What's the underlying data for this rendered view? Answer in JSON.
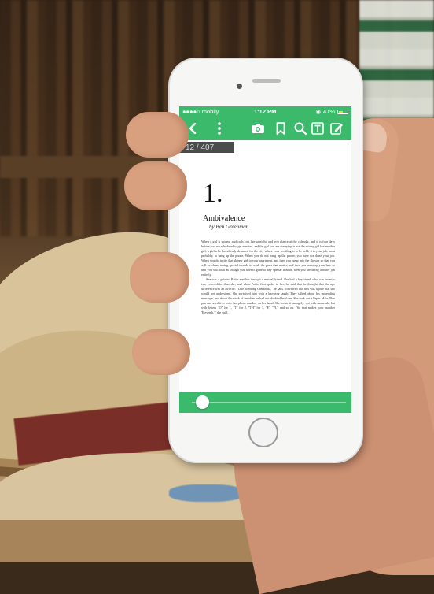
{
  "status_bar": {
    "carrier": "●●●●○ mobily",
    "time": "1:12 PM",
    "battery": "41%",
    "accent_color": "#3cba6c"
  },
  "toolbar": {
    "icons": [
      "back-icon",
      "more-vert-icon",
      "camera-icon",
      "bookmark-icon",
      "search-icon",
      "text-size-icon",
      "edit-note-icon"
    ]
  },
  "reader": {
    "page_counter": "12 / 407",
    "chapter_number": "1.",
    "chapter_title": "Ambivalence",
    "author": "by Ben Greenman",
    "paragraphs": [
      "When a girl is skinny, and calls you late at night, and you glance at the calendar, and it is four days before you are scheduled to get married, and the girl you are marrying is not the skinny girl but another girl, a girl who has already departed for the city where your wedding is to be held, it is your job, most probably, to hang up the phone. When you do not hang up the phone, you have not done your job. When you do invite that skinny girl to your apartment, and then you jump into the shower so that you will be clean, taking special trouble to wash the parts that matter, and then you mess up your hair so that you will look as though you haven't gone to any special trouble, then you are doing another job entirely.",
      "She was a painter. Pattie met her through a mutual friend. She had a boyfriend, who was twenty-two years older than she, and when Pattie first spoke to her, he said that he thought that the age difference was an atrocity. \"Like bombing Cambodia,\" he said, convinced that this was a joke that she would not understand. She surprised him with a knowing laugh. They talked about his impending marriage, and about the week of freedom he had not doubted he'd use. She took out a Paper Mate Blue pen and used it to write her phone number on her hand. She wrote it strangely: not with numerals, but with letters \"O\" for 1, \"T\" for 2, \"TH\" for 3, \"F,\" \"FI,\" and so on. \"So that makes your number 'Eleventh,'\" she said."
    ],
    "progress": 0.03
  }
}
